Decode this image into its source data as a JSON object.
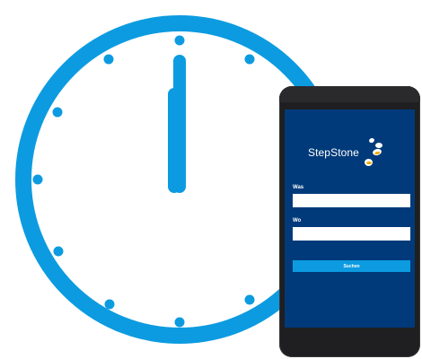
{
  "illustration": {
    "clock_color": "#0c9be0",
    "dial_color": "#ffffff",
    "hands_time": "12:00"
  },
  "phone": {
    "screen_color": "#003a7a",
    "app": {
      "brand_name": "StepStone",
      "logo_accent": "#f2a900",
      "what_label": "Was",
      "what_value": "",
      "where_label": "Wo",
      "where_value": "",
      "search_label": "Suchen",
      "button_color": "#0c9be0"
    }
  }
}
